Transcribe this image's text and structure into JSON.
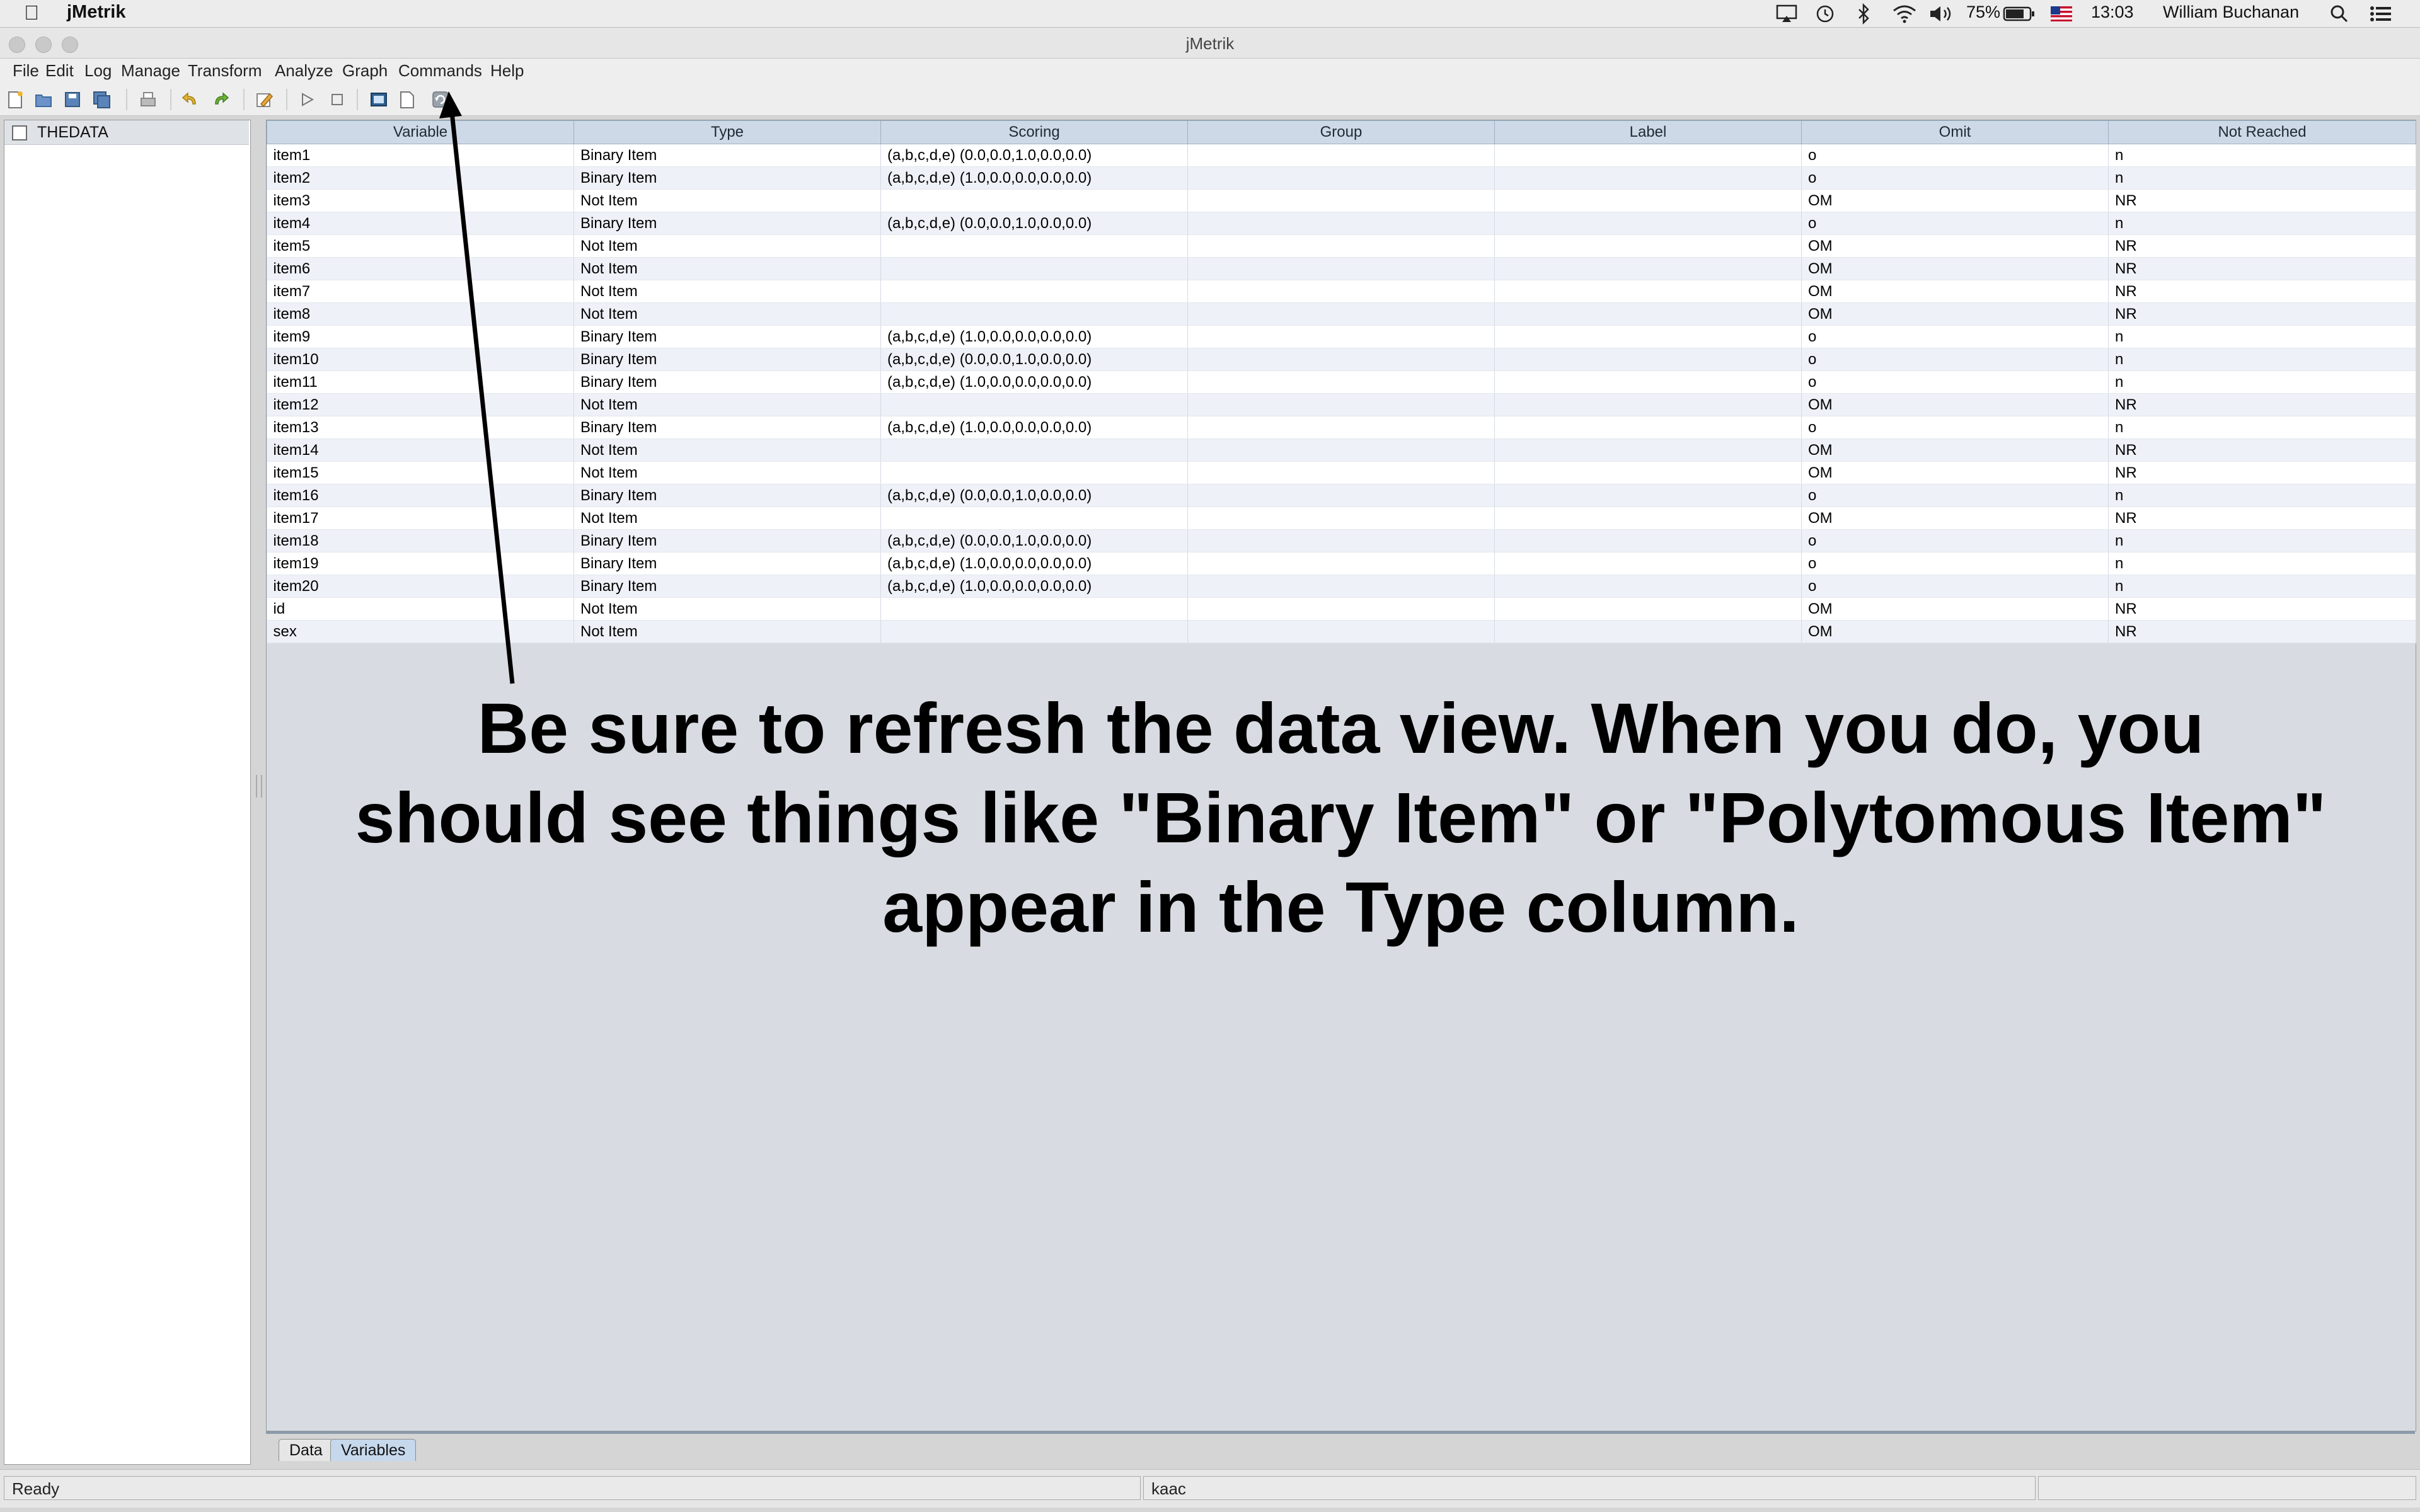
{
  "os_menubar": {
    "app_name": "jMetrik",
    "battery": "75%",
    "time": "13:03",
    "user": "William Buchanan"
  },
  "window": {
    "title": "jMetrik"
  },
  "menu": [
    "File",
    "Edit",
    "Log",
    "Manage",
    "Transform",
    "Analyze",
    "Graph",
    "Commands",
    "Help"
  ],
  "tree": {
    "item_label": "THEDATA"
  },
  "table": {
    "columns": [
      "Variable",
      "Type",
      "Scoring",
      "Group",
      "Label",
      "Omit",
      "Not Reached"
    ],
    "rows": [
      [
        "item1",
        "Binary Item",
        "(a,b,c,d,e) (0.0,0.0,1.0,0.0,0.0)",
        "",
        "",
        "o",
        "n"
      ],
      [
        "item2",
        "Binary Item",
        "(a,b,c,d,e) (1.0,0.0,0.0,0.0,0.0)",
        "",
        "",
        "o",
        "n"
      ],
      [
        "item3",
        "Not Item",
        "",
        "",
        "",
        "OM",
        "NR"
      ],
      [
        "item4",
        "Binary Item",
        "(a,b,c,d,e) (0.0,0.0,1.0,0.0,0.0)",
        "",
        "",
        "o",
        "n"
      ],
      [
        "item5",
        "Not Item",
        "",
        "",
        "",
        "OM",
        "NR"
      ],
      [
        "item6",
        "Not Item",
        "",
        "",
        "",
        "OM",
        "NR"
      ],
      [
        "item7",
        "Not Item",
        "",
        "",
        "",
        "OM",
        "NR"
      ],
      [
        "item8",
        "Not Item",
        "",
        "",
        "",
        "OM",
        "NR"
      ],
      [
        "item9",
        "Binary Item",
        "(a,b,c,d,e) (1.0,0.0,0.0,0.0,0.0)",
        "",
        "",
        "o",
        "n"
      ],
      [
        "item10",
        "Binary Item",
        "(a,b,c,d,e) (0.0,0.0,1.0,0.0,0.0)",
        "",
        "",
        "o",
        "n"
      ],
      [
        "item11",
        "Binary Item",
        "(a,b,c,d,e) (1.0,0.0,0.0,0.0,0.0)",
        "",
        "",
        "o",
        "n"
      ],
      [
        "item12",
        "Not Item",
        "",
        "",
        "",
        "OM",
        "NR"
      ],
      [
        "item13",
        "Binary Item",
        "(a,b,c,d,e) (1.0,0.0,0.0,0.0,0.0)",
        "",
        "",
        "o",
        "n"
      ],
      [
        "item14",
        "Not Item",
        "",
        "",
        "",
        "OM",
        "NR"
      ],
      [
        "item15",
        "Not Item",
        "",
        "",
        "",
        "OM",
        "NR"
      ],
      [
        "item16",
        "Binary Item",
        "(a,b,c,d,e) (0.0,0.0,1.0,0.0,0.0)",
        "",
        "",
        "o",
        "n"
      ],
      [
        "item17",
        "Not Item",
        "",
        "",
        "",
        "OM",
        "NR"
      ],
      [
        "item18",
        "Binary Item",
        "(a,b,c,d,e) (0.0,0.0,1.0,0.0,0.0)",
        "",
        "",
        "o",
        "n"
      ],
      [
        "item19",
        "Binary Item",
        "(a,b,c,d,e) (1.0,0.0,0.0,0.0,0.0)",
        "",
        "",
        "o",
        "n"
      ],
      [
        "item20",
        "Binary Item",
        "(a,b,c,d,e) (1.0,0.0,0.0,0.0,0.0)",
        "",
        "",
        "o",
        "n"
      ],
      [
        "id",
        "Not Item",
        "",
        "",
        "",
        "OM",
        "NR"
      ],
      [
        "sex",
        "Not Item",
        "",
        "",
        "",
        "OM",
        "NR"
      ]
    ]
  },
  "annotation": {
    "line1": "Be sure to refresh the data view.  When you do, you",
    "line2": "should see things like \"Binary Item\" or \"Polytomous Item\"",
    "line3": "appear in the Type column."
  },
  "tabs": {
    "data": "Data",
    "variables": "Variables"
  },
  "status": {
    "left": "Ready",
    "middle": "kaac",
    "right": ""
  }
}
